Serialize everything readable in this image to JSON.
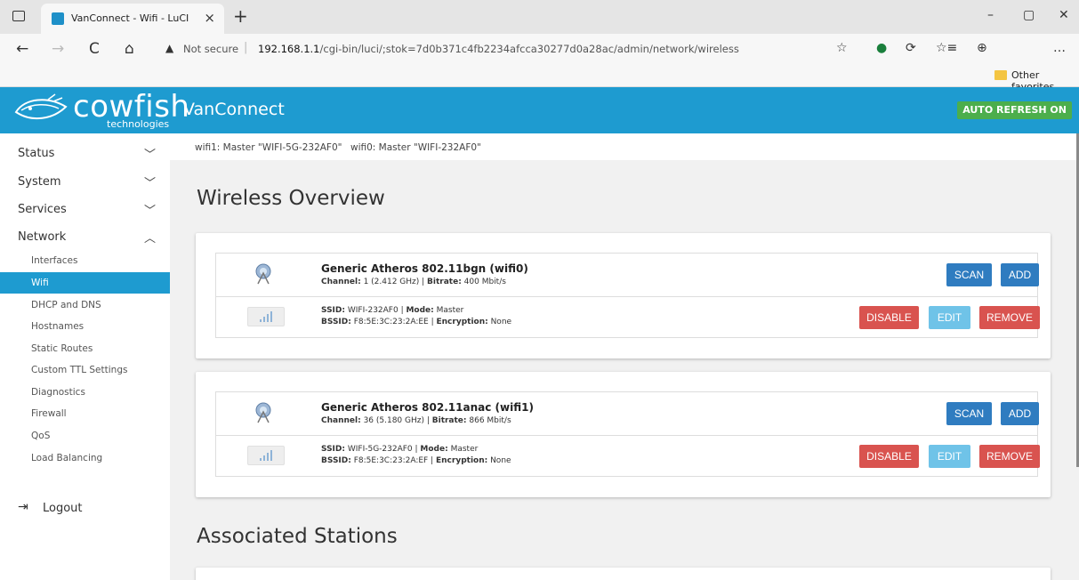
{
  "browser": {
    "tab_title": "VanConnect - Wifi - LuCI",
    "tab_close": "×",
    "new_tab": "+",
    "address_warning": "Not secure",
    "address_separator": "|",
    "url_host": "192.168.1.1",
    "url_path": "/cgi-bin/luci/;stok=7d0b371c4fb2234afcca30277d0a28ac/admin/network/wireless",
    "favorites_label": "Other favorites",
    "window_controls": [
      "–",
      "▢",
      "✕"
    ],
    "nav_icons": [
      "←",
      "→",
      "C",
      "⌂"
    ],
    "toolbar_icons": [
      "☆",
      "●",
      "⟳",
      "☆≡",
      "⊕",
      "…"
    ]
  },
  "header": {
    "logo_text": "cowfish",
    "logo_sub": "technologies",
    "brand": "VanConnect",
    "auto_refresh": "AUTO REFRESH ON",
    "accent_color": "#1e9bd0"
  },
  "sidebar": {
    "menus": [
      {
        "label": "Status",
        "chevron": "﹀"
      },
      {
        "label": "System",
        "chevron": "﹀"
      },
      {
        "label": "Services",
        "chevron": "﹀"
      },
      {
        "label": "Network",
        "chevron": "︿"
      }
    ],
    "network_items": [
      {
        "label": "Interfaces"
      },
      {
        "label": "Wifi"
      },
      {
        "label": "DHCP and DNS"
      },
      {
        "label": "Hostnames"
      },
      {
        "label": "Static Routes"
      },
      {
        "label": "Custom TTL Settings"
      },
      {
        "label": "Diagnostics"
      },
      {
        "label": "Firewall"
      },
      {
        "label": "QoS"
      },
      {
        "label": "Load Balancing"
      }
    ],
    "logout_icon": "⇥",
    "logout": "Logout"
  },
  "main": {
    "status_items": [
      "wifi1: Master \"WIFI-5G-232AF0\"",
      "wifi0: Master \"WIFI-232AF0\""
    ],
    "wireless_title": "Wireless Overview",
    "stations_title": "Associated Stations",
    "devices": [
      {
        "name": "Generic Atheros 802.11bgn (wifi0)",
        "channel_label": "Channel:",
        "channel_value": " 1 (2.412 GHz) | ",
        "bitrate_label": "Bitrate:",
        "bitrate_value": " 400 Mbit/s",
        "scan": "SCAN",
        "add": "ADD",
        "network": {
          "ssid_label": "SSID:",
          "ssid_value": " WIFI-232AF0 | ",
          "mode_label": "Mode:",
          "mode_value": " Master",
          "bssid_label": "BSSID:",
          "bssid_value": " F8:5E:3C:23:2A:EE | ",
          "enc_label": "Encryption:",
          "enc_value": " None",
          "disable": "DISABLE",
          "edit": "EDIT",
          "remove": "REMOVE"
        }
      },
      {
        "name": "Generic Atheros 802.11anac (wifi1)",
        "channel_label": "Channel:",
        "channel_value": " 36 (5.180 GHz) | ",
        "bitrate_label": "Bitrate:",
        "bitrate_value": " 866 Mbit/s",
        "scan": "SCAN",
        "add": "ADD",
        "network": {
          "ssid_label": "SSID:",
          "ssid_value": " WIFI-5G-232AF0 | ",
          "mode_label": "Mode:",
          "mode_value": " Master",
          "bssid_label": "BSSID:",
          "bssid_value": " F8:5E:3C:23:2A:EF | ",
          "enc_label": "Encryption:",
          "enc_value": " None",
          "disable": "DISABLE",
          "edit": "EDIT",
          "remove": "REMOVE"
        }
      }
    ]
  }
}
